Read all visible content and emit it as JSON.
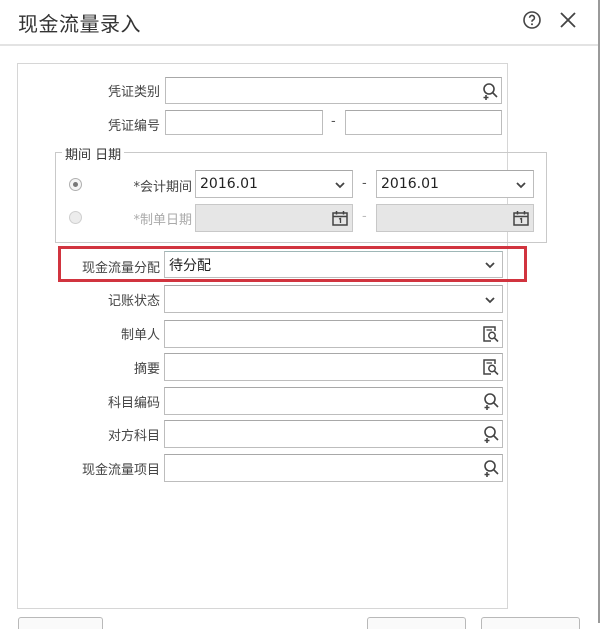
{
  "dialog": {
    "title": "现金流量录入",
    "help_icon": "help-circle-icon",
    "close_icon": "close-icon"
  },
  "form": {
    "voucher_type": {
      "label": "凭证类别",
      "value": "",
      "icon": "search-add-icon"
    },
    "voucher_number": {
      "label": "凭证编号",
      "from": "",
      "to": "",
      "separator": "-"
    },
    "period_group": {
      "legend": "期间 日期",
      "accounting_period": {
        "label": "*会计期间",
        "selected": true,
        "from": "2016.01",
        "to": "2016.01",
        "separator": "-"
      },
      "voucher_date": {
        "label": "*制单日期",
        "selected": false,
        "from": "",
        "to": "",
        "separator": "-",
        "disabled": true,
        "icon": "calendar-icon"
      }
    },
    "cashflow_allocation": {
      "label": "现金流量分配",
      "value": "待分配",
      "highlight_color": "#d1343f"
    },
    "posting_status": {
      "label": "记账状态",
      "value": ""
    },
    "preparer": {
      "label": "制单人",
      "value": "",
      "icon": "lookup-list-icon"
    },
    "summary": {
      "label": "摘要",
      "value": "",
      "icon": "lookup-list-icon"
    },
    "account_code": {
      "label": "科目编码",
      "value": "",
      "icon": "search-add-icon"
    },
    "counter_account": {
      "label": "对方科目",
      "value": "",
      "icon": "search-add-icon"
    },
    "cashflow_item": {
      "label": "现金流量项目",
      "value": "",
      "icon": "search-add-icon"
    }
  }
}
